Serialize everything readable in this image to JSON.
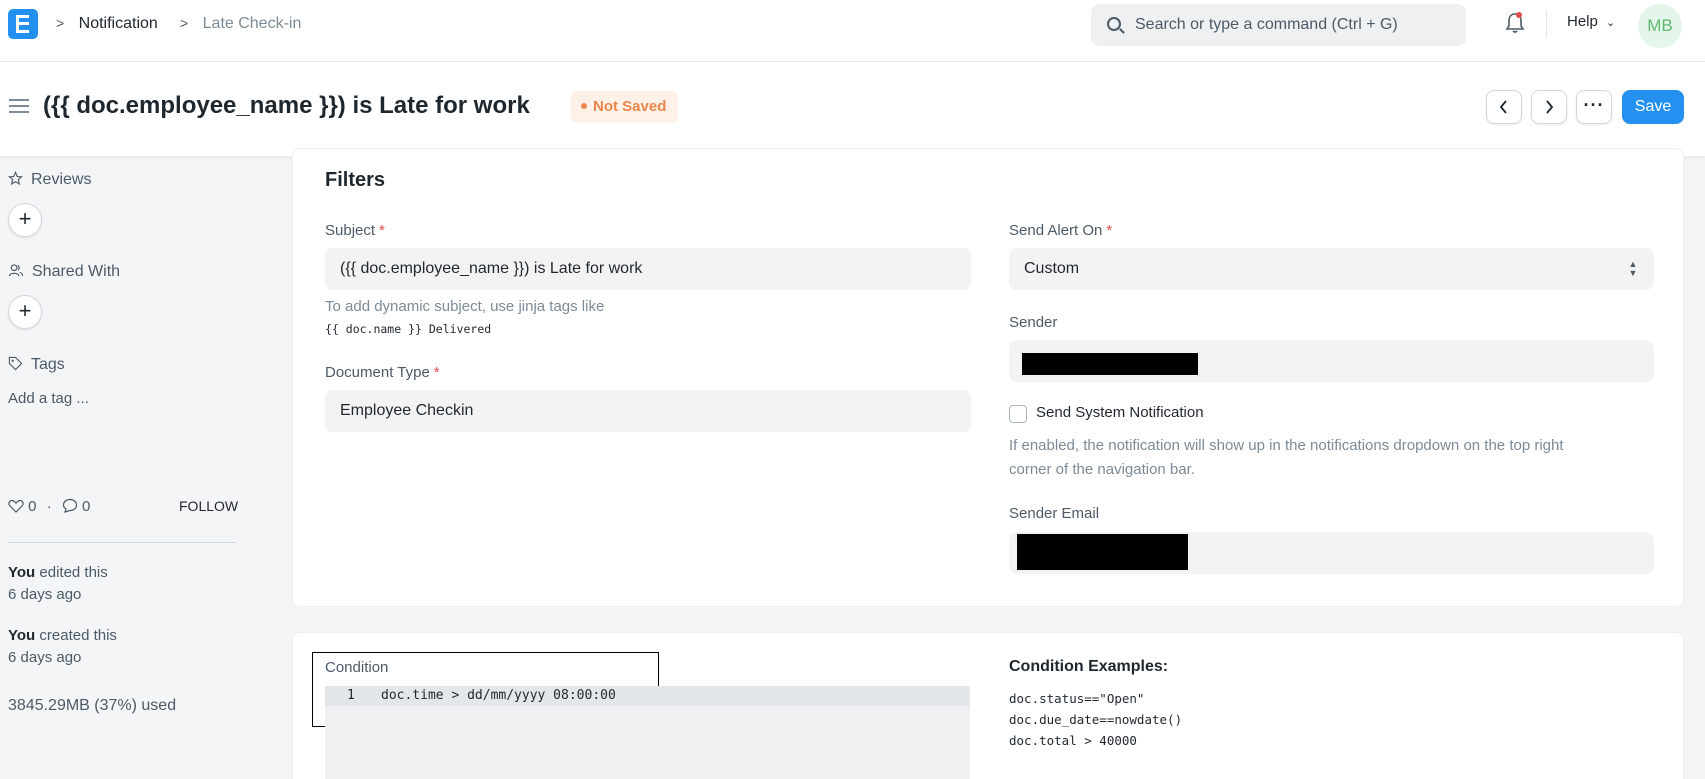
{
  "navbar": {
    "breadcrumbs": [
      "Notification",
      "Late Check-in"
    ],
    "search_placeholder": "Search or type a command (Ctrl + G)",
    "help_label": "Help",
    "avatar_initials": "MB"
  },
  "page": {
    "title": "({{ doc.employee_name }}) is Late for work",
    "status": "Not Saved",
    "save_label": "Save",
    "more_label": "···"
  },
  "sidebar": {
    "reviews_label": "Reviews",
    "shared_with_label": "Shared With",
    "tags_label": "Tags",
    "add_tag_placeholder": "Add a tag ...",
    "likes_count": "0",
    "comments_count": "0",
    "follow_label": "FOLLOW",
    "activity": [
      {
        "actor": "You",
        "action": " edited this",
        "when": "6 days ago"
      },
      {
        "actor": "You",
        "action": " created this",
        "when": "6 days ago"
      }
    ],
    "storage_used": "3845.29MB (37%) used"
  },
  "filters": {
    "section_title": "Filters",
    "subject_label": "Subject",
    "subject_value": "({{ doc.employee_name }}) is Late for work",
    "subject_help": "To add dynamic subject, use jinja tags like",
    "subject_help_code": "{{ doc.name }} Delivered",
    "document_type_label": "Document Type",
    "document_type_value": "Employee Checkin",
    "send_alert_on_label": "Send Alert On",
    "send_alert_on_value": "Custom",
    "sender_label": "Sender",
    "send_system_notification_label": "Send System Notification",
    "send_system_notification_checked": false,
    "send_system_notification_help_1": "If enabled, the notification will show up in the notifications dropdown on the top right",
    "send_system_notification_help_2": "corner of the navigation bar.",
    "sender_email_label": "Sender Email",
    "required_mark": "*"
  },
  "condition": {
    "label": "Condition",
    "line_number": "1",
    "code": "doc.time > dd/mm/yyyy 08:00:00",
    "examples_title": "Condition Examples:",
    "examples": [
      "doc.status==\"Open\"",
      "doc.due_date==nowdate()",
      "doc.total > 40000"
    ]
  },
  "colors": {
    "accent": "#2490ef",
    "status_orange": "#ec864b",
    "required_red": "#e24c4c"
  }
}
